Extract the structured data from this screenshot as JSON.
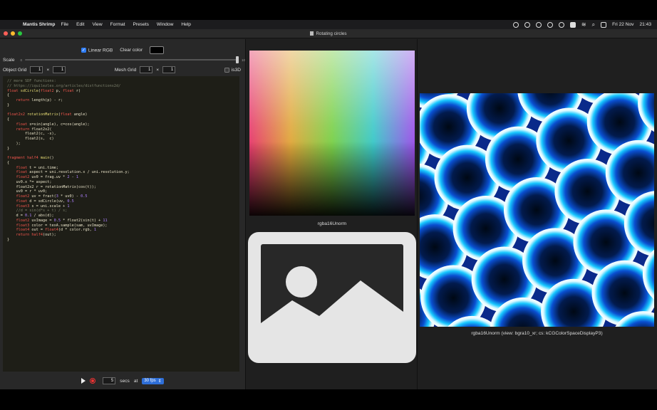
{
  "menubar": {
    "app_name": "Mantis Shrimp",
    "items": [
      "File",
      "Edit",
      "View",
      "Format",
      "Presets",
      "Window",
      "Help"
    ],
    "date": "Fri 22 Nov",
    "time": "21:43"
  },
  "window": {
    "title": "Rotating circles"
  },
  "controls": {
    "linear_rgb_label": "Linear RGB",
    "linear_rgb_checked": true,
    "clear_color_label": "Clear color",
    "scale_label": "Scale",
    "scale_min": "0",
    "scale_max": "10",
    "scale_value_fraction": 1.0,
    "object_grid_label": "Object Grid",
    "object_grid_x": "1",
    "object_grid_y": "1",
    "mesh_grid_label": "Mesh Grid",
    "mesh_grid_x": "1",
    "mesh_grid_y": "1",
    "times": "×",
    "is3d_label": "is3D",
    "is3d_checked": false
  },
  "code_lines": [
    [
      [
        "cm",
        "// more SDF functions:"
      ]
    ],
    [
      [
        "cm",
        "// https://iquilezles.org/articles/distfunctions2d/"
      ]
    ],
    [
      [
        "ty",
        "float "
      ],
      [
        "fn",
        "sdCircle"
      ],
      [
        "",
        "("
      ],
      [
        "ty",
        "float2"
      ],
      [
        "",
        " p, "
      ],
      [
        "ty",
        "float"
      ],
      [
        "",
        " r)"
      ]
    ],
    [
      [
        "",
        "{"
      ]
    ],
    [
      [
        "",
        "    "
      ],
      [
        "kw",
        "return"
      ],
      [
        "",
        " length(p) - r;"
      ]
    ],
    [
      [
        "",
        "}"
      ]
    ],
    [
      [
        "",
        ""
      ]
    ],
    [
      [
        "ty",
        "float2x2 "
      ],
      [
        "fn",
        "rotationMatrix"
      ],
      [
        "",
        "("
      ],
      [
        "ty",
        "float"
      ],
      [
        "",
        " angle)"
      ]
    ],
    [
      [
        "",
        "{"
      ]
    ],
    [
      [
        "",
        "    "
      ],
      [
        "ty",
        "float"
      ],
      [
        "",
        " s=sin(angle), c=cos(angle);"
      ]
    ],
    [
      [
        "",
        "    "
      ],
      [
        "kw",
        "return"
      ],
      [
        "",
        " float2x2("
      ]
    ],
    [
      [
        "",
        "        float2(c, -s),"
      ]
    ],
    [
      [
        "",
        "        float2(s,  c)"
      ]
    ],
    [
      [
        "",
        "    );"
      ]
    ],
    [
      [
        "",
        "}"
      ]
    ],
    [
      [
        "",
        ""
      ]
    ],
    [
      [
        "kw",
        "fragment "
      ],
      [
        "ty",
        "half4 "
      ],
      [
        "fn",
        "main"
      ],
      [
        "",
        "()"
      ]
    ],
    [
      [
        "",
        "{"
      ]
    ],
    [
      [
        "",
        "    "
      ],
      [
        "ty",
        "float"
      ],
      [
        "",
        " t = uni.time;"
      ]
    ],
    [
      [
        "",
        "    "
      ],
      [
        "ty",
        "float"
      ],
      [
        "",
        " aspect = uni.resolution.x / uni.resolution.y;"
      ]
    ],
    [
      [
        "",
        "    "
      ],
      [
        "ty",
        "float2"
      ],
      [
        "",
        " uv0 = frag.uv * "
      ],
      [
        "nm",
        "2"
      ],
      [
        "",
        " - "
      ],
      [
        "nm",
        "1"
      ],
      [
        ";"
      ]
    ],
    [
      [
        "",
        "    uv0.x *= aspect;"
      ]
    ],
    [
      [
        "",
        "    float2x2 r = rotationMatrix(cos(t));"
      ]
    ],
    [
      [
        "",
        "    uv0 = r * uv0;"
      ]
    ],
    [
      [
        "",
        "    "
      ],
      [
        "ty",
        "float2"
      ],
      [
        "",
        " uv = fract("
      ],
      [
        "nm",
        "3"
      ],
      [
        "",
        " * uv0) - "
      ],
      [
        "nm",
        "0.5"
      ],
      [
        ";"
      ]
    ],
    [
      [
        "",
        "    "
      ],
      [
        "ty",
        "float"
      ],
      [
        "",
        " d = sdCircle(uv, "
      ],
      [
        "nm",
        "0.5"
      ],
      [
        ") * exp(-length(uv0));"
      ]
    ],
    [
      [
        "",
        "    "
      ],
      [
        "ty",
        "float3"
      ],
      [
        "",
        " s = uni.scale + "
      ],
      [
        "nm",
        "1"
      ],
      [
        ";"
      ]
    ],
    [
      [
        "",
        "    "
      ],
      [
        "cm",
        "//d = sin(d*s + t) / s;"
      ]
    ],
    [
      [
        "",
        "    d = "
      ],
      [
        "nm",
        "0.1"
      ],
      [
        "",
        " / abs(d);"
      ]
    ],
    [
      [
        "",
        "    "
      ],
      [
        "ty",
        "float2"
      ],
      [
        "",
        " uvImage = "
      ],
      [
        "nm",
        "0.5"
      ],
      [
        "",
        " * float2(sin(t) + "
      ],
      [
        "nm",
        "1"
      ],
      [
        ", cos(t) + "
      ],
      [
        "nm",
        "1"
      ],
      [
        ");"
      ]
    ],
    [
      [
        "",
        "    "
      ],
      [
        "ty",
        "float3"
      ],
      [
        "",
        " color = texA.sample(sam, uvImage);"
      ]
    ],
    [
      [
        "",
        "    "
      ],
      [
        "ty",
        "float4"
      ],
      [
        "",
        " out = "
      ],
      [
        "ty",
        "float4"
      ],
      [
        "",
        "(d * color.rgb, "
      ],
      [
        "nm",
        "1"
      ],
      [
        ");"
      ]
    ],
    [
      [
        "",
        "    "
      ],
      [
        "kw",
        "return"
      ],
      [
        "",
        " "
      ],
      [
        "ty",
        "half4"
      ],
      [
        "",
        "(out);"
      ]
    ],
    [
      [
        "",
        "}"
      ]
    ]
  ],
  "playback": {
    "seconds": "5",
    "secs_label": "secs",
    "at_label": "at",
    "fps_value": "30 fps"
  },
  "middle": {
    "texture_format_label": "rgba16Unorm"
  },
  "right": {
    "output_format_label": "rgba16Unorm (view: bgra10_xr; cs: kCGColorSpaceDisplayP3)"
  },
  "colors": {
    "accent": "#2f7df6",
    "glow": "#18c8ff"
  }
}
